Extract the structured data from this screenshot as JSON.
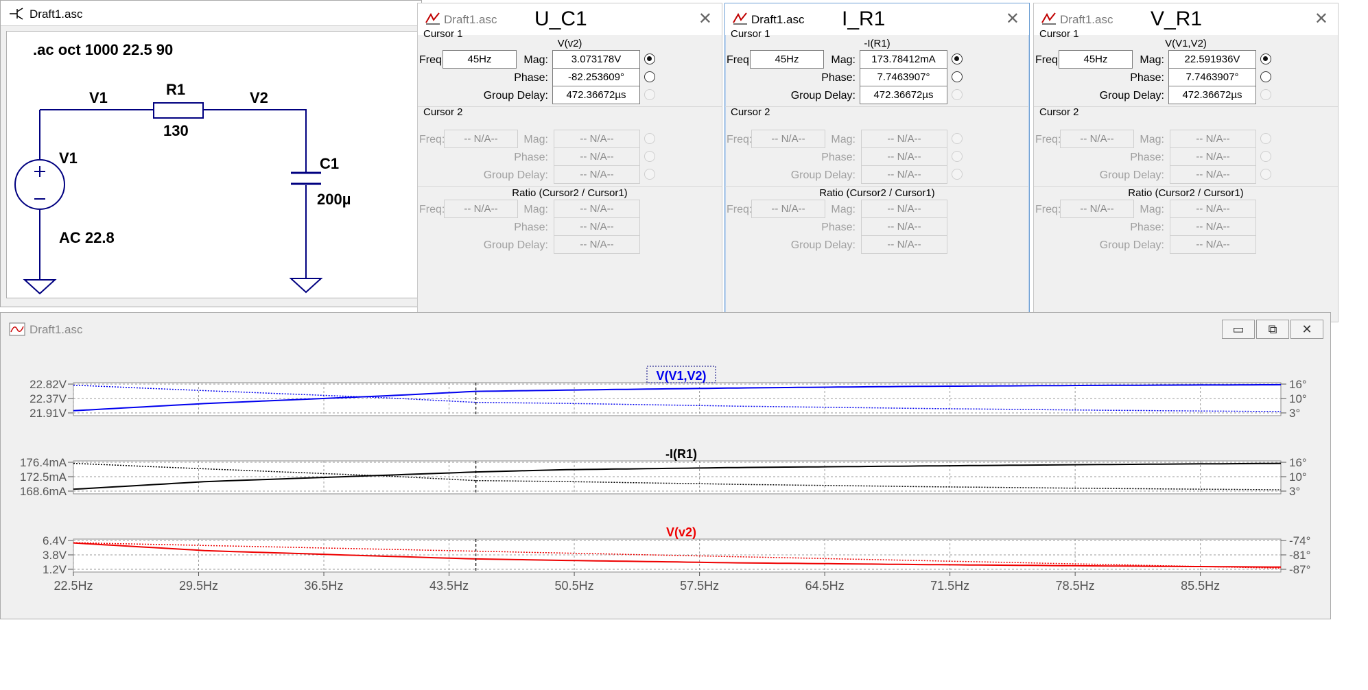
{
  "schematic": {
    "title": "Draft1.asc",
    "directive": ".ac oct 1000 22.5 90",
    "labels": {
      "net_v1": "V1",
      "r1_name": "R1",
      "r1_value": "130",
      "net_v2": "V2",
      "source_name": "V1",
      "source_value": "AC 22.8",
      "c1_name": "C1",
      "c1_value": "200µ"
    }
  },
  "dialogs": [
    {
      "file": "Draft1.asc",
      "handle": "U_C1",
      "active": false,
      "cursor1_label": "Cursor 1",
      "expr": "V(v2)",
      "freq": "45Hz",
      "mag": "3.073178V",
      "phase": "-82.253609°",
      "group_delay": "472.36672µs"
    },
    {
      "file": "Draft1.asc",
      "handle": "I_R1",
      "active": true,
      "cursor1_label": "Cursor 1",
      "expr": "-I(R1)",
      "freq": "45Hz",
      "mag": "173.78412mA",
      "phase": "7.7463907°",
      "group_delay": "472.36672µs"
    },
    {
      "file": "Draft1.asc",
      "handle": "V_R1",
      "active": false,
      "cursor1_label": "Cursor 1",
      "expr": "V(V1,V2)",
      "freq": "45Hz",
      "mag": "22.591936V",
      "phase": "7.7463907°",
      "group_delay": "472.36672µs"
    }
  ],
  "dialog_common": {
    "freq_label": "Freq:",
    "mag_label": "Mag:",
    "phase_label": "Phase:",
    "gd_label": "Group Delay:",
    "cursor2_label": "Cursor 2",
    "ratio_label": "Ratio (Cursor2 / Cursor1)",
    "na": "-- N/A--"
  },
  "waveform": {
    "title": "Draft1.asc",
    "buttons": {
      "minimize": "▭",
      "restore": "⧉",
      "close": "✕"
    },
    "cursor_freq": 45,
    "colors": {
      "blue": "#0000ee",
      "black": "#000000",
      "red": "#ee0000"
    }
  },
  "chart_data": [
    {
      "type": "line",
      "title": "V(V1,V2)",
      "color": "#0000ee",
      "x_ticks": [
        "22.5Hz",
        "29.5Hz",
        "36.5Hz",
        "43.5Hz",
        "50.5Hz",
        "57.5Hz",
        "64.5Hz",
        "71.5Hz",
        "78.5Hz",
        "85.5Hz"
      ],
      "xlim": [
        22.5,
        90
      ],
      "left_ticks": [
        "22.82V",
        "22.37V",
        "21.91V"
      ],
      "ylim_left": [
        21.91,
        22.82
      ],
      "right_ticks": [
        "16°",
        "10°",
        "3°"
      ],
      "ylim_right": [
        3,
        16
      ],
      "magnitude": {
        "x": [
          22.5,
          30,
          40,
          45,
          50,
          60,
          70,
          80,
          90
        ],
        "y": [
          21.98,
          22.21,
          22.45,
          22.59,
          22.63,
          22.7,
          22.75,
          22.78,
          22.8
        ]
      },
      "phase": {
        "x": [
          22.5,
          30,
          40,
          45,
          50,
          60,
          70,
          80,
          90
        ],
        "y": [
          15.5,
          13.0,
          9.8,
          7.75,
          7.3,
          6.0,
          5.0,
          4.2,
          3.6
        ]
      }
    },
    {
      "type": "line",
      "title": "-I(R1)",
      "color": "#000000",
      "left_ticks": [
        "176.4mA",
        "172.5mA",
        "168.6mA"
      ],
      "ylim_left": [
        168.6,
        176.4
      ],
      "right_ticks": [
        "16°",
        "10°",
        "3°"
      ],
      "ylim_right": [
        3,
        16
      ],
      "magnitude": {
        "x": [
          22.5,
          30,
          40,
          45,
          50,
          60,
          70,
          80,
          90
        ],
        "y": [
          169.1,
          171.2,
          172.9,
          173.78,
          174.4,
          175.0,
          175.4,
          175.8,
          176.1
        ]
      },
      "phase": {
        "x": [
          22.5,
          30,
          40,
          45,
          50,
          60,
          70,
          80,
          90
        ],
        "y": [
          15.5,
          13.0,
          9.8,
          7.75,
          7.3,
          6.0,
          5.0,
          4.2,
          3.6
        ]
      }
    },
    {
      "type": "line",
      "title": "V(v2)",
      "color": "#ee0000",
      "left_ticks": [
        "6.4V",
        "3.8V",
        "1.2V"
      ],
      "ylim_left": [
        1.2,
        6.4
      ],
      "right_ticks": [
        "-74°",
        "-81°",
        "-87°"
      ],
      "ylim_right": [
        -87,
        -74
      ],
      "magnitude": {
        "x": [
          22.5,
          30,
          40,
          45,
          50,
          60,
          70,
          80,
          90
        ],
        "y": [
          5.95,
          4.55,
          3.55,
          3.07,
          2.8,
          2.35,
          2.05,
          1.8,
          1.6
        ]
      },
      "phase": {
        "x": [
          22.5,
          90
        ],
        "y": [
          -75.0,
          -86.5
        ]
      }
    }
  ]
}
